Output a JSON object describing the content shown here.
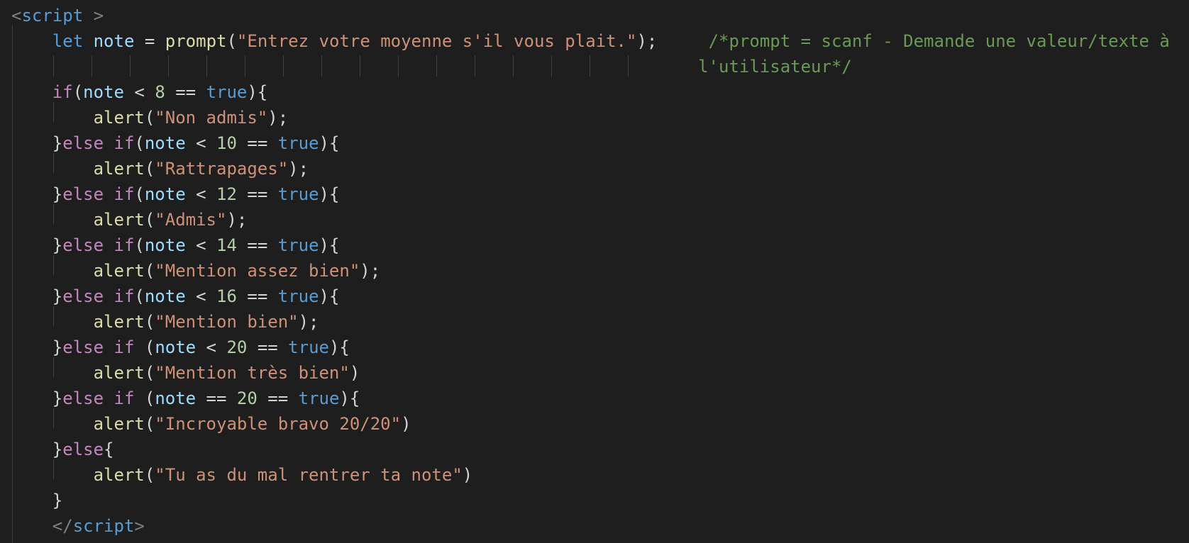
{
  "editor": {
    "theme_colors": {
      "background": "#1e1e1e",
      "keyword": "#569cd6",
      "control": "#c586c0",
      "variable": "#9cdcfe",
      "function": "#dcdcaa",
      "string": "#ce9178",
      "number": "#b5cea8",
      "comment": "#6a9955"
    },
    "lines": [
      [
        {
          "t": "<",
          "c": "tagbr"
        },
        {
          "t": "script",
          "c": "tag"
        },
        {
          "t": " >",
          "c": "tagbr"
        }
      ],
      [
        {
          "t": "    "
        },
        {
          "t": "let",
          "c": "kw"
        },
        {
          "t": " "
        },
        {
          "t": "note",
          "c": "var"
        },
        {
          "t": " = "
        },
        {
          "t": "prompt",
          "c": "fn"
        },
        {
          "t": "("
        },
        {
          "t": "\"Entrez votre moyenne s'il vous plait.\"",
          "c": "str"
        },
        {
          "t": ");     "
        },
        {
          "t": "/*prompt = scanf - Demande une valeur/texte à",
          "c": "cmt"
        }
      ],
      [
        {
          "t": "                                                                   "
        },
        {
          "t": "l'utilisateur*/",
          "c": "cmt"
        }
      ],
      [
        {
          "t": "    "
        },
        {
          "t": "if",
          "c": "ctl"
        },
        {
          "t": "("
        },
        {
          "t": "note",
          "c": "var"
        },
        {
          "t": " < "
        },
        {
          "t": "8",
          "c": "num"
        },
        {
          "t": " == "
        },
        {
          "t": "true",
          "c": "kw"
        },
        {
          "t": "){"
        }
      ],
      [
        {
          "t": "        "
        },
        {
          "t": "alert",
          "c": "fn"
        },
        {
          "t": "("
        },
        {
          "t": "\"Non admis\"",
          "c": "str"
        },
        {
          "t": ");"
        }
      ],
      [
        {
          "t": "    }"
        },
        {
          "t": "else",
          "c": "ctl"
        },
        {
          "t": " "
        },
        {
          "t": "if",
          "c": "ctl"
        },
        {
          "t": "("
        },
        {
          "t": "note",
          "c": "var"
        },
        {
          "t": " < "
        },
        {
          "t": "10",
          "c": "num"
        },
        {
          "t": " == "
        },
        {
          "t": "true",
          "c": "kw"
        },
        {
          "t": "){"
        }
      ],
      [
        {
          "t": "        "
        },
        {
          "t": "alert",
          "c": "fn"
        },
        {
          "t": "("
        },
        {
          "t": "\"Rattrapages\"",
          "c": "str"
        },
        {
          "t": ");"
        }
      ],
      [
        {
          "t": "    }"
        },
        {
          "t": "else",
          "c": "ctl"
        },
        {
          "t": " "
        },
        {
          "t": "if",
          "c": "ctl"
        },
        {
          "t": "("
        },
        {
          "t": "note",
          "c": "var"
        },
        {
          "t": " < "
        },
        {
          "t": "12",
          "c": "num"
        },
        {
          "t": " == "
        },
        {
          "t": "true",
          "c": "kw"
        },
        {
          "t": "){"
        }
      ],
      [
        {
          "t": "        "
        },
        {
          "t": "alert",
          "c": "fn"
        },
        {
          "t": "("
        },
        {
          "t": "\"Admis\"",
          "c": "str"
        },
        {
          "t": ");"
        }
      ],
      [
        {
          "t": "    }"
        },
        {
          "t": "else",
          "c": "ctl"
        },
        {
          "t": " "
        },
        {
          "t": "if",
          "c": "ctl"
        },
        {
          "t": "("
        },
        {
          "t": "note",
          "c": "var"
        },
        {
          "t": " < "
        },
        {
          "t": "14",
          "c": "num"
        },
        {
          "t": " == "
        },
        {
          "t": "true",
          "c": "kw"
        },
        {
          "t": "){"
        }
      ],
      [
        {
          "t": "        "
        },
        {
          "t": "alert",
          "c": "fn"
        },
        {
          "t": "("
        },
        {
          "t": "\"Mention assez bien\"",
          "c": "str"
        },
        {
          "t": ");"
        }
      ],
      [
        {
          "t": "    }"
        },
        {
          "t": "else",
          "c": "ctl"
        },
        {
          "t": " "
        },
        {
          "t": "if",
          "c": "ctl"
        },
        {
          "t": "("
        },
        {
          "t": "note",
          "c": "var"
        },
        {
          "t": " < "
        },
        {
          "t": "16",
          "c": "num"
        },
        {
          "t": " == "
        },
        {
          "t": "true",
          "c": "kw"
        },
        {
          "t": "){"
        }
      ],
      [
        {
          "t": "        "
        },
        {
          "t": "alert",
          "c": "fn"
        },
        {
          "t": "("
        },
        {
          "t": "\"Mention bien\"",
          "c": "str"
        },
        {
          "t": ");"
        }
      ],
      [
        {
          "t": "    }"
        },
        {
          "t": "else",
          "c": "ctl"
        },
        {
          "t": " "
        },
        {
          "t": "if",
          "c": "ctl"
        },
        {
          "t": " ("
        },
        {
          "t": "note",
          "c": "var"
        },
        {
          "t": " < "
        },
        {
          "t": "20",
          "c": "num"
        },
        {
          "t": " == "
        },
        {
          "t": "true",
          "c": "kw"
        },
        {
          "t": "){"
        }
      ],
      [
        {
          "t": "        "
        },
        {
          "t": "alert",
          "c": "fn"
        },
        {
          "t": "("
        },
        {
          "t": "\"Mention très bien\"",
          "c": "str"
        },
        {
          "t": ")"
        }
      ],
      [
        {
          "t": "    }"
        },
        {
          "t": "else",
          "c": "ctl"
        },
        {
          "t": " "
        },
        {
          "t": "if",
          "c": "ctl"
        },
        {
          "t": " ("
        },
        {
          "t": "note",
          "c": "var"
        },
        {
          "t": " == "
        },
        {
          "t": "20",
          "c": "num"
        },
        {
          "t": " == "
        },
        {
          "t": "true",
          "c": "kw"
        },
        {
          "t": "){"
        }
      ],
      [
        {
          "t": "        "
        },
        {
          "t": "alert",
          "c": "fn"
        },
        {
          "t": "("
        },
        {
          "t": "\"Incroyable bravo 20/20\"",
          "c": "str"
        },
        {
          "t": ")"
        }
      ],
      [
        {
          "t": "    }"
        },
        {
          "t": "else",
          "c": "ctl"
        },
        {
          "t": "{"
        }
      ],
      [
        {
          "t": "        "
        },
        {
          "t": "alert",
          "c": "fn"
        },
        {
          "t": "("
        },
        {
          "t": "\"Tu as du mal rentrer ta note\"",
          "c": "str"
        },
        {
          "t": ")"
        }
      ],
      [
        {
          "t": "    }"
        }
      ],
      [
        {
          "t": "    "
        },
        {
          "t": "</",
          "c": "tagbr"
        },
        {
          "t": "script",
          "c": "tag"
        },
        {
          "t": ">",
          "c": "tagbr"
        }
      ]
    ]
  }
}
